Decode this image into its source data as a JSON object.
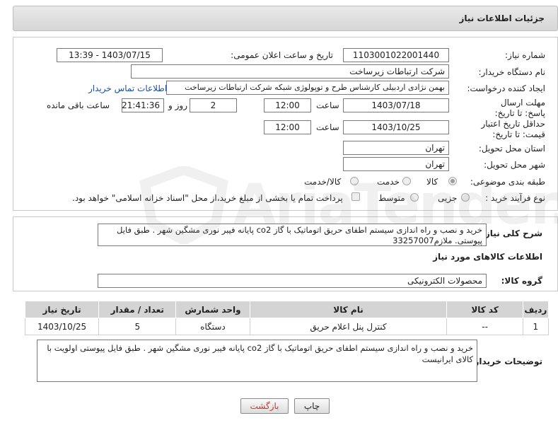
{
  "header": {
    "title": "جزئیات اطلاعات نیاز"
  },
  "fields": {
    "need_number_label": "شماره نیاز:",
    "need_number": "1103001022001440",
    "announce_label": "تاریخ و ساعت اعلان عمومی:",
    "announce_value": "1403/07/15 - 13:39",
    "buyer_org_label": "نام دستگاه خریدار:",
    "buyer_org": "شرکت ارتباطات زیرساخت",
    "creator_label": "ایجاد کننده درخواست:",
    "creator": "بهمن نژادی اردبیلی کارشناس طرح و توپولوژی شبکه شرکت ارتباطات زیرساخت",
    "contact_link": "اطلاعات تماس خریدار",
    "reply_deadline_label": "مهلت ارسال پاسخ: تا تاریخ:",
    "reply_date": "1403/07/18",
    "time_label": "ساعت",
    "reply_time": "12:00",
    "days_value": "2",
    "days_label": "روز و",
    "remaining_time": "21:41:36",
    "remaining_label": "ساعت باقی مانده",
    "price_validity_label": "حداقل تاریخ اعتبار قیمت: تا تاریخ:",
    "price_date": "1403/10/25",
    "price_time": "12:00",
    "province_label": "استان محل تحویل:",
    "province": "تهران",
    "city_label": "شهر محل تحویل:",
    "city": "تهران",
    "category_label": "طبقه بندی موضوعی:",
    "category_options": [
      "کالا",
      "خدمت",
      "کالا/خدمت"
    ],
    "process_label": "نوع فرآیند خرید :",
    "process_options": [
      "جزیی",
      "متوسط"
    ],
    "payment_note": "پرداخت تمام یا بخشی از مبلغ خرید،از محل \"اسناد خزانه اسلامی\" خواهد بود."
  },
  "description": {
    "label": "شرح کلی نیاز:",
    "text": "خرید و نصب و راه اندازی سیستم اطفای حریق اتوماتیک با گاز co2 پایانه فیبر نوری مشگین شهر . طبق فایل پیوستی. ملازم33257007"
  },
  "goods_section": {
    "title": "اطلاعات کالاهای مورد نیاز",
    "group_label": "گروه کالا:",
    "group_value": "محصولات الکترونیکی"
  },
  "table": {
    "headers": [
      "ردیف",
      "کد کالا",
      "نام کالا",
      "واحد شمارش",
      "تعداد / مقدار",
      "تاریخ نیاز"
    ],
    "rows": [
      [
        "1",
        "--",
        "کنترل پنل اعلام حریق",
        "دستگاه",
        "5",
        "1403/10/25"
      ]
    ]
  },
  "buyer_notes": {
    "label": "توضیحات خریدار:",
    "text": "خرید و نصب و راه اندازی سیستم اطفای حریق اتوماتیک با گاز co2 پایانه فیبر نوری مشگین شهر . طبق فایل پیوستی اولویت با کالای ایرانیست"
  },
  "buttons": {
    "print": "چاپ",
    "back": "بازگشت"
  },
  "watermark": "AriaTender.neT",
  "colors": {
    "link": "#1a4fa3",
    "header_bg": "#dcdcdc",
    "back_button_text": "#c0392b"
  }
}
